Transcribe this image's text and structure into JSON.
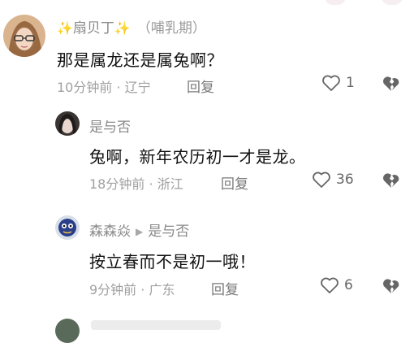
{
  "comments": [
    {
      "username": "扇贝丁",
      "user_tag": "（哺乳期）",
      "text": "那是属龙还是属兔啊？",
      "time_location": "10分钟前 · 辽宁",
      "reply_label": "回复",
      "like_count": "1"
    },
    {
      "username": "是与否",
      "text": "兔啊，新年农历初一才是龙。",
      "time_location": "18分钟前 · 浙江",
      "reply_label": "回复",
      "like_count": "36"
    },
    {
      "username": "森森焱",
      "reply_to": "是与否",
      "text": "按立春而不是初一哦！",
      "time_location": "9分钟前 · 广东",
      "reply_label": "回复",
      "like_count": "6"
    }
  ],
  "icons": {
    "sparkle": "sparkle-icon",
    "like": "heart-icon",
    "dislike": "broken-heart-icon",
    "reply_arrow": "reply-arrow-icon"
  },
  "colors": {
    "primary_text": "#111111",
    "secondary_text": "#8a8a8a",
    "sparkle": "#f2c230"
  }
}
